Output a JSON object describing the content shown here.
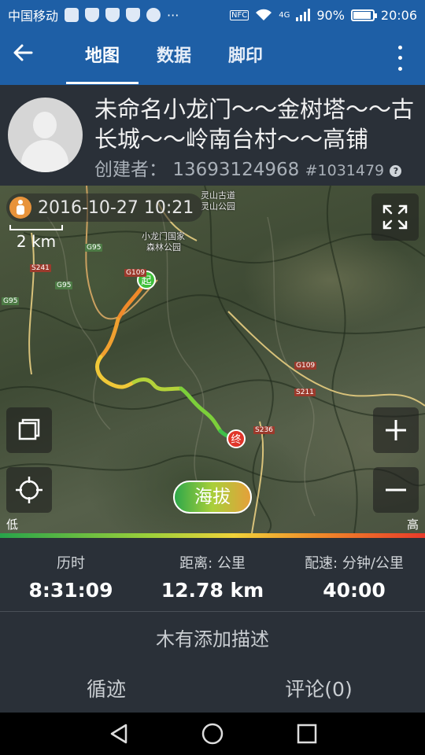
{
  "status_bar": {
    "carrier": "中国移动",
    "more": "···",
    "nfc": "NFC",
    "network": "4G",
    "battery": "90%",
    "battery_level": 0.9,
    "time": "20:06"
  },
  "app_bar": {
    "tabs": [
      {
        "label": "地图",
        "active": true
      },
      {
        "label": "数据",
        "active": false
      },
      {
        "label": "脚印",
        "active": false
      }
    ]
  },
  "header": {
    "title": "未命名小龙门～～金树塔～～古长城～～岭南台村～～高铺",
    "creator_label": "创建者：",
    "creator_name": "13693124968",
    "record_id": "#1031479",
    "help": "?"
  },
  "map": {
    "datetime": "2016-10-27 10:21",
    "scale": "2 km",
    "start_marker": "起",
    "end_marker": "终",
    "altitude_button": "海拔",
    "legend_low": "低",
    "legend_high": "高",
    "place_labels": [
      "灵山古道",
      "灵山公园",
      "小龙门国家",
      "森林公园"
    ],
    "road_labels": [
      "G95",
      "S241",
      "G95",
      "G95",
      "G109",
      "G109",
      "S211",
      "S236"
    ]
  },
  "stats": [
    {
      "label": "历时",
      "value": "8:31:09"
    },
    {
      "label": "距离: 公里",
      "value": "12.78 km"
    },
    {
      "label": "配速: 分钟/公里",
      "value": "40:00"
    }
  ],
  "description": "木有添加描述",
  "bottom_tabs": [
    "循迹",
    "评论(0)"
  ],
  "colors": {
    "primary": "#1e5fa6",
    "panel": "#2a3038",
    "accent": "#e8933a"
  },
  "icons": [
    "back-arrow-icon",
    "more-vert-icon",
    "fullscreen-icon",
    "layers-icon",
    "locate-icon",
    "zoom-in-icon",
    "zoom-out-icon",
    "walker-icon",
    "help-icon",
    "nav-back-icon",
    "nav-home-icon",
    "nav-recents-icon"
  ]
}
